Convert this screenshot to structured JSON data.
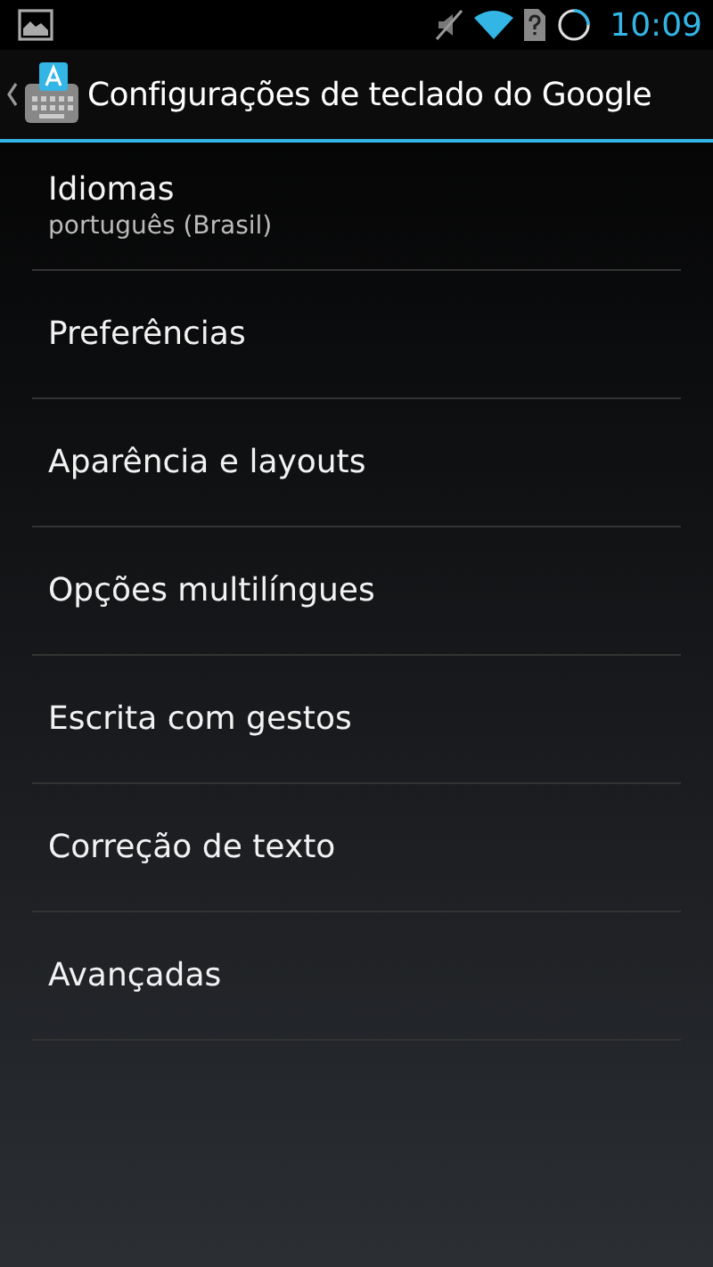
{
  "status_bar": {
    "time": "10:09"
  },
  "action_bar": {
    "title": "Configurações de teclado do Google"
  },
  "items": [
    {
      "title": "Idiomas",
      "summary": "português (Brasil)"
    },
    {
      "title": "Preferências"
    },
    {
      "title": "Aparência e layouts"
    },
    {
      "title": "Opções multilíngues"
    },
    {
      "title": "Escrita com gestos"
    },
    {
      "title": "Correção de texto"
    },
    {
      "title": "Avançadas"
    }
  ]
}
